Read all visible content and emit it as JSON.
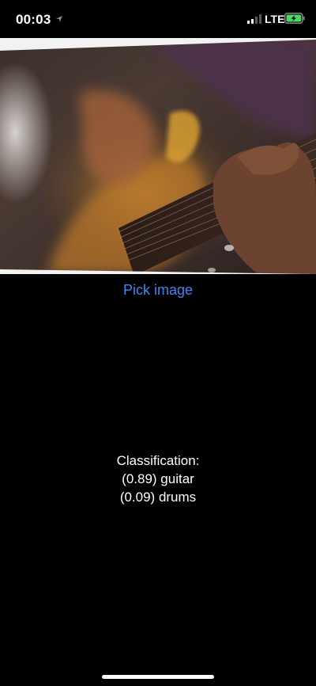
{
  "status_bar": {
    "time": "00:03",
    "network": "LTE",
    "location_icon": "location-arrow-icon",
    "signal_icon": "cellular-signal-icon",
    "battery_icon": "battery-charging-icon",
    "battery_color": "#4cd964"
  },
  "photo": {
    "subject": "guitar-photo"
  },
  "actions": {
    "pick_label": "Pick image",
    "accent_color": "#3d87f5"
  },
  "classification": {
    "heading": "Classification:",
    "results": [
      {
        "text": "(0.89) guitar"
      },
      {
        "text": "(0.09) drums"
      }
    ]
  }
}
